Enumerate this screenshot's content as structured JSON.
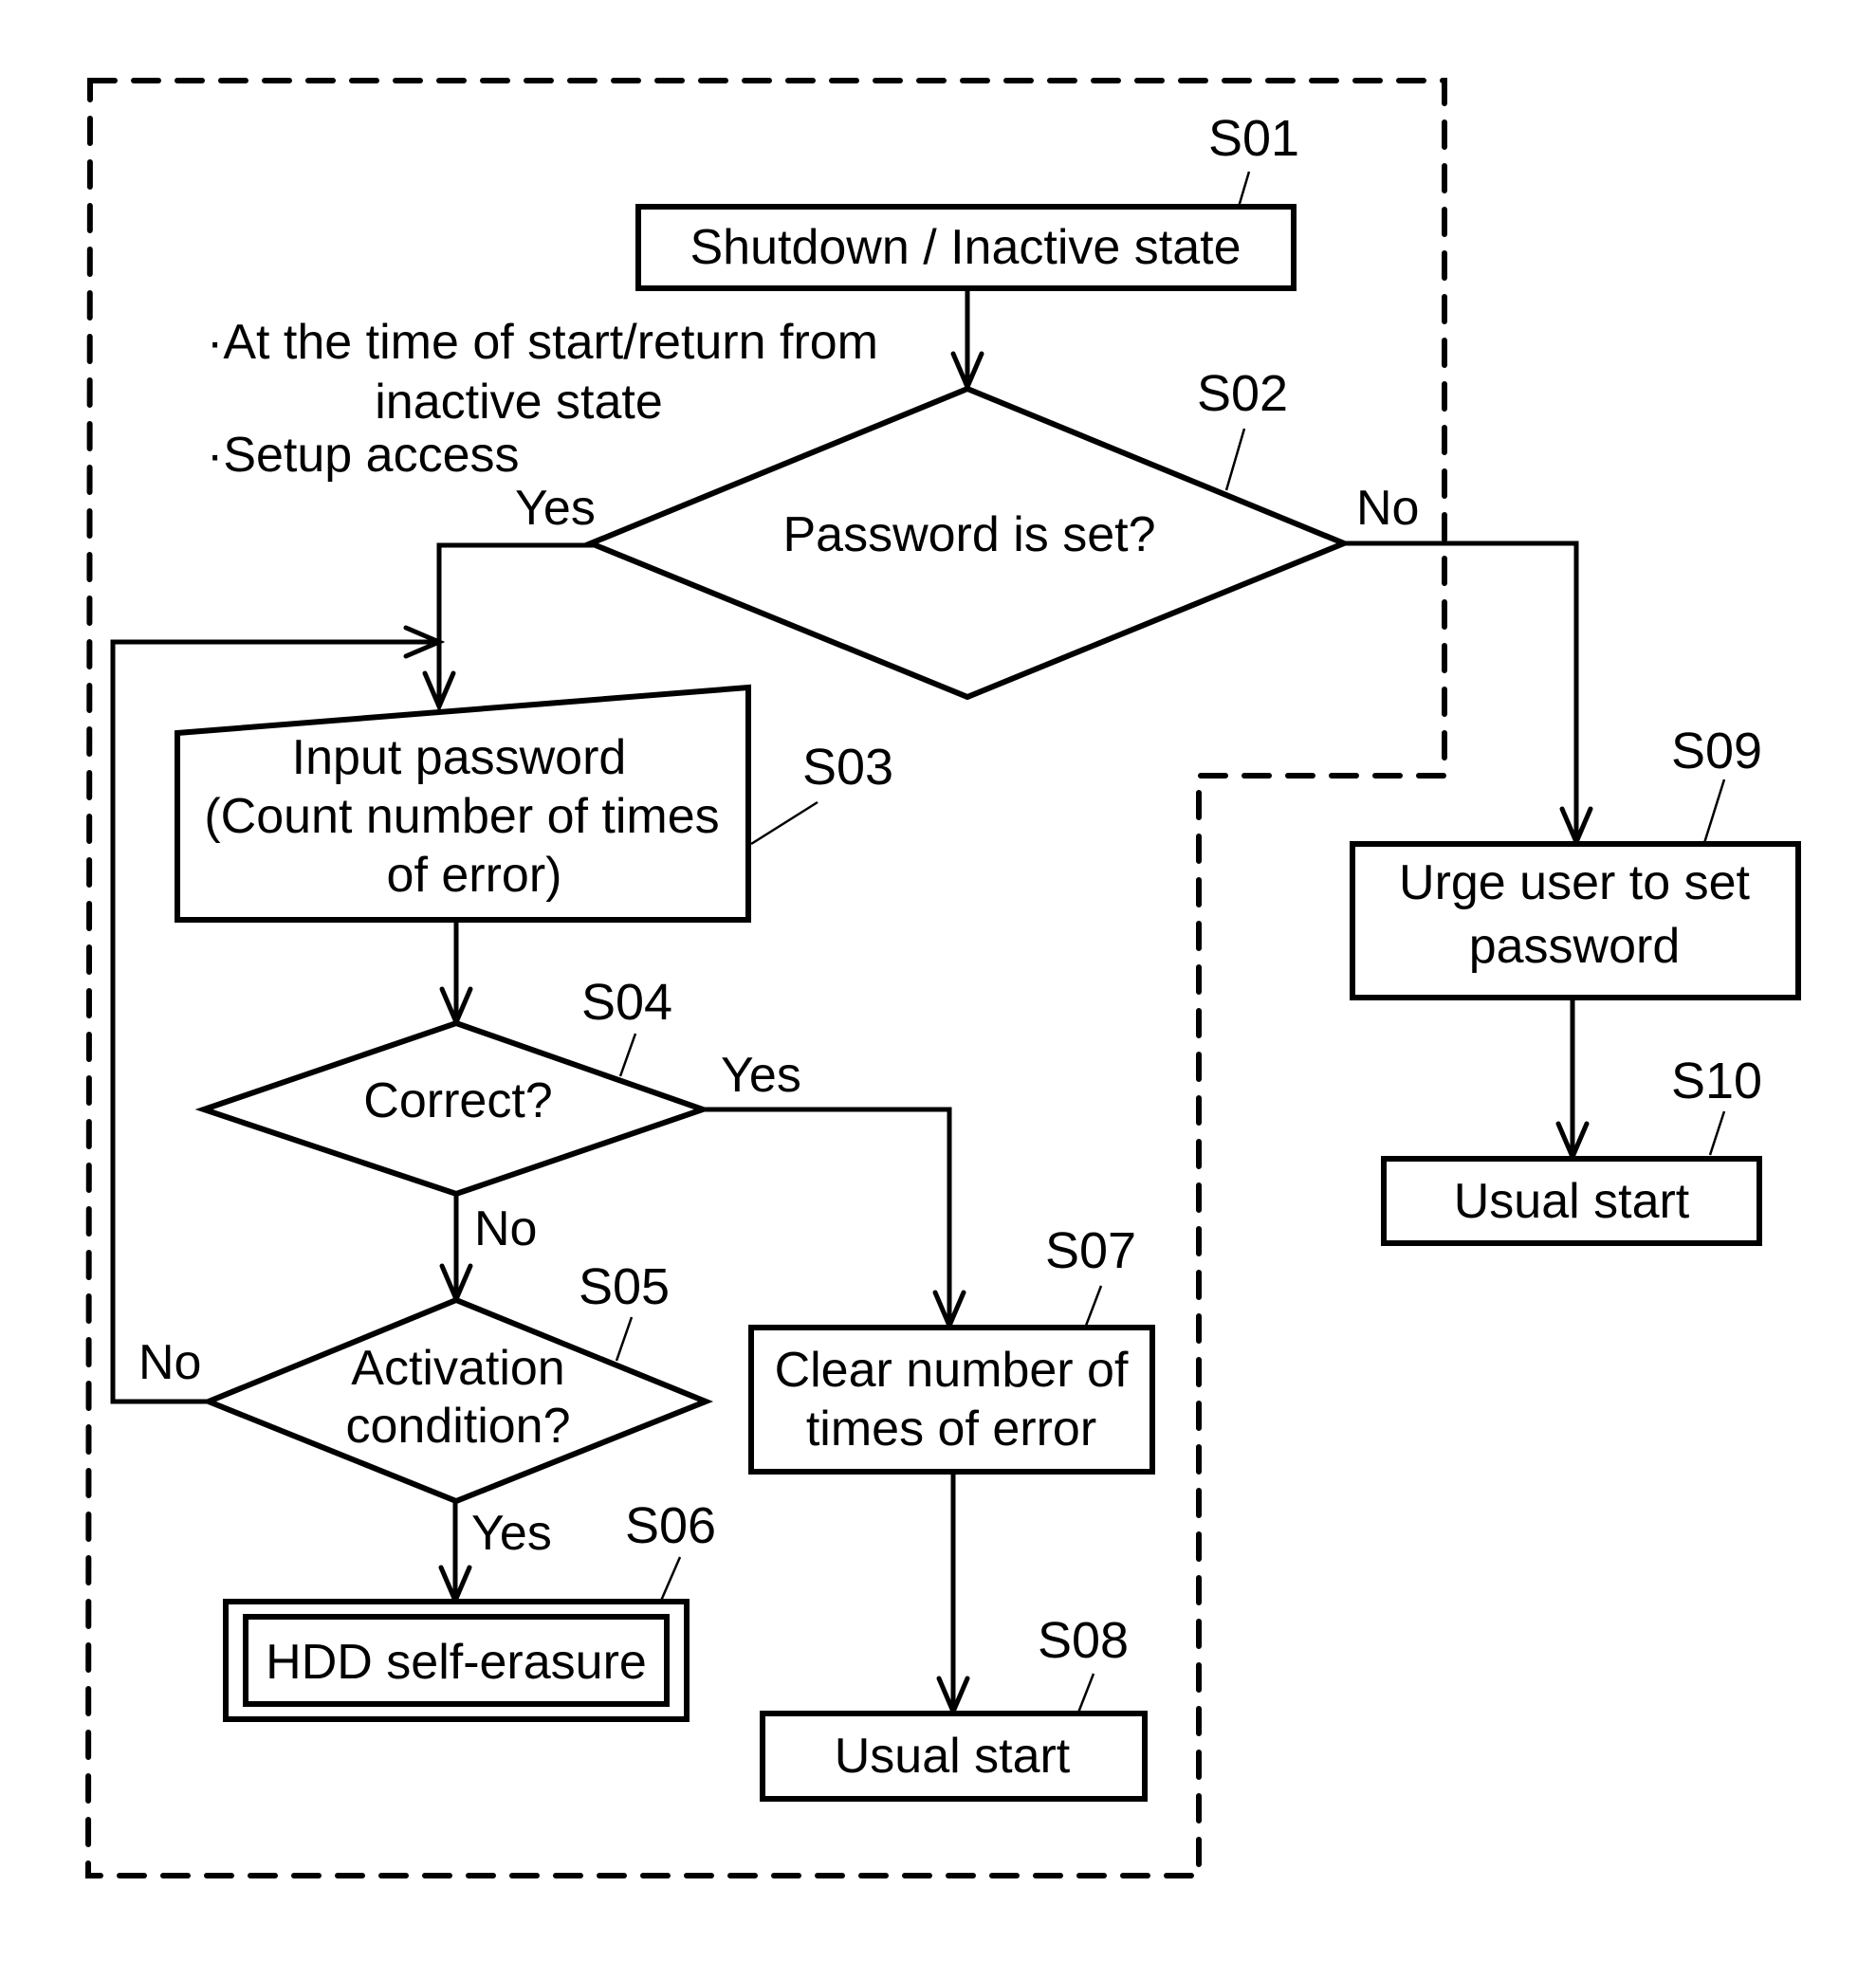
{
  "diagram": {
    "type": "flowchart",
    "region_note": {
      "lines": [
        "·At the time of start/return from",
        "inactive state",
        "·Setup access"
      ]
    },
    "steps": {
      "S01": {
        "id": "S01",
        "shape": "process",
        "lines": [
          "Shutdown / Inactive state"
        ]
      },
      "S02": {
        "id": "S02",
        "shape": "decision",
        "lines": [
          "Password is set?"
        ]
      },
      "S03": {
        "id": "S03",
        "shape": "manual-input",
        "lines": [
          "Input password",
          "(Count number of times",
          "of error)"
        ]
      },
      "S04": {
        "id": "S04",
        "shape": "decision",
        "lines": [
          "Correct?"
        ]
      },
      "S05": {
        "id": "S05",
        "shape": "decision",
        "lines": [
          "Activation",
          "condition?"
        ]
      },
      "S06": {
        "id": "S06",
        "shape": "double-process",
        "lines": [
          "HDD self-erasure"
        ]
      },
      "S07": {
        "id": "S07",
        "shape": "process",
        "lines": [
          "Clear number of",
          "times of error"
        ]
      },
      "S08": {
        "id": "S08",
        "shape": "process",
        "lines": [
          "Usual start"
        ]
      },
      "S09": {
        "id": "S09",
        "shape": "process",
        "lines": [
          "Urge user to set",
          "password"
        ]
      },
      "S10": {
        "id": "S10",
        "shape": "process",
        "lines": [
          "Usual start"
        ]
      }
    },
    "branch_labels": {
      "s02_yes": "Yes",
      "s02_no": "No",
      "s04_yes": "Yes",
      "s04_no": "No",
      "s05_no": "No",
      "s05_yes": "Yes"
    },
    "edges": [
      {
        "from": "S01",
        "to": "S02",
        "label": ""
      },
      {
        "from": "S02",
        "to": "S03",
        "label": "Yes"
      },
      {
        "from": "S02",
        "to": "S09",
        "label": "No"
      },
      {
        "from": "S03",
        "to": "S04",
        "label": ""
      },
      {
        "from": "S04",
        "to": "S07",
        "label": "Yes"
      },
      {
        "from": "S04",
        "to": "S05",
        "label": "No"
      },
      {
        "from": "S05",
        "to": "S03",
        "label": "No"
      },
      {
        "from": "S05",
        "to": "S06",
        "label": "Yes"
      },
      {
        "from": "S07",
        "to": "S08",
        "label": ""
      },
      {
        "from": "S09",
        "to": "S10",
        "label": ""
      }
    ]
  }
}
